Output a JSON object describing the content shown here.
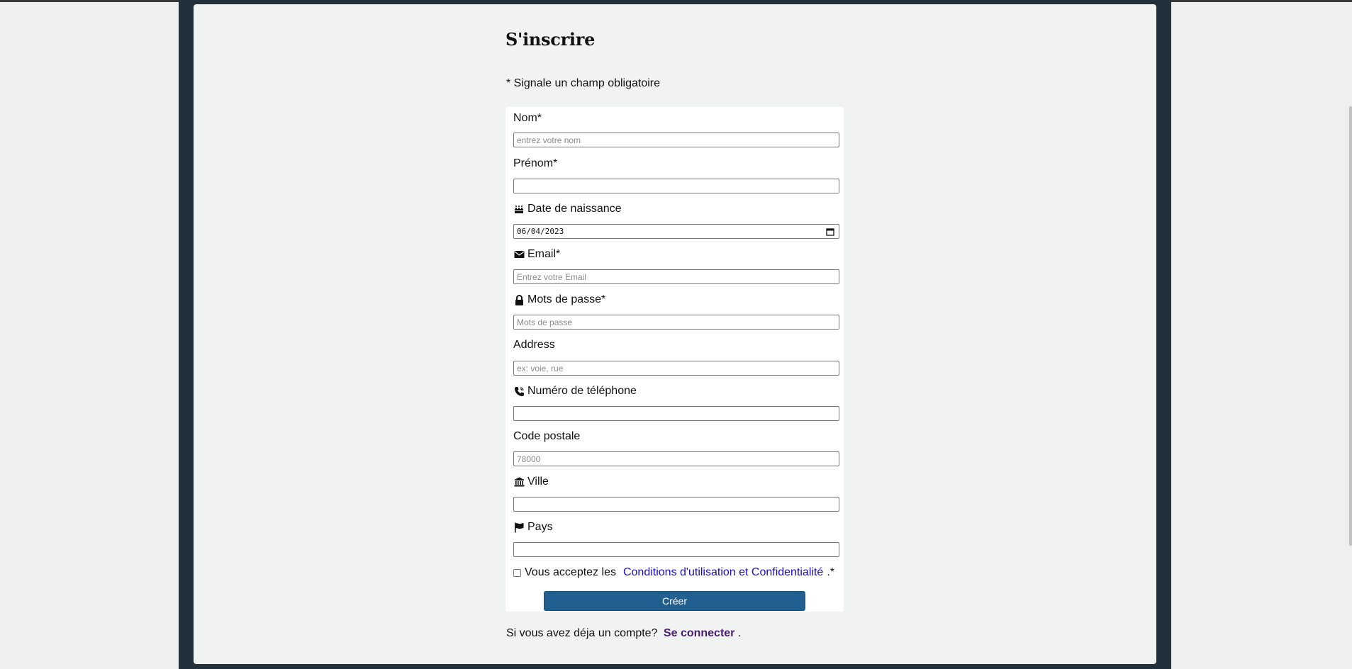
{
  "page": {
    "title": "S'inscrire",
    "required_note": "* Signale un champ obligatoire"
  },
  "form": {
    "nom": {
      "label": "Nom*",
      "placeholder": "entrez votre nom",
      "value": ""
    },
    "prenom": {
      "label": "Prénom*",
      "placeholder": "",
      "value": ""
    },
    "birthdate": {
      "label": "Date de naissance",
      "icon": "birthday-cake-icon",
      "value": "06/04/2023",
      "picker_icon": "calendar-icon"
    },
    "email": {
      "label": "Email*",
      "icon": "envelope-icon",
      "placeholder": "Entrez votre Email",
      "value": ""
    },
    "password": {
      "label": "Mots de passe*",
      "icon": "lock-icon",
      "placeholder": "Mots de passe",
      "value": ""
    },
    "address": {
      "label": "Address",
      "placeholder": "ex: voie, rue",
      "value": ""
    },
    "phone": {
      "label": "Numéro de téléphone",
      "icon": "phone-icon",
      "placeholder": "",
      "value": ""
    },
    "postal": {
      "label": "Code postale",
      "placeholder": "78000",
      "value": ""
    },
    "city": {
      "label": "Ville",
      "icon": "bank-icon",
      "placeholder": "",
      "value": ""
    },
    "country": {
      "label": "Pays",
      "icon": "flag-icon",
      "placeholder": "",
      "value": ""
    },
    "terms": {
      "prefix": "Vous acceptez les",
      "link": "Conditions d'utilisation et Confidentialité",
      "suffix": ".*",
      "checked": false
    },
    "submit_label": "Créer"
  },
  "login": {
    "prefix": "Si vous avez déja un compte?",
    "link": "Se connecter",
    "suffix": "."
  },
  "colors": {
    "frame": "#22303c",
    "content_bg": "#f1f2f2",
    "button": "#205f8f",
    "link": "#1a0dcc",
    "login_link": "#4b1c70"
  }
}
